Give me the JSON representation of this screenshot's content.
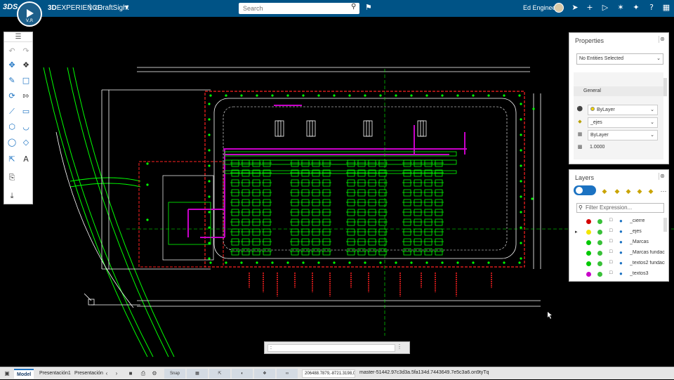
{
  "topbar": {
    "logo": "3DS",
    "compass_version": "V,R",
    "brand_bold": "3D",
    "brand_rest": "EXPERIENCE",
    "separator": "|",
    "app_name": "xDraftSight",
    "search_placeholder": "Search",
    "user_name": "Ed Engineer",
    "icons": [
      "tag-icon",
      "share-icon",
      "plus-icon",
      "play-icon",
      "network-icon",
      "tools-icon",
      "help-icon",
      "grid-icon"
    ]
  },
  "toolbar": {
    "handle": "☰",
    "tools": [
      "undo-icon",
      "redo-icon",
      "move-icon",
      "select-icon",
      "pen-icon",
      "rectangle-icon",
      "rotate-icon",
      "arrow-icon",
      "line-icon",
      "box-icon",
      "polygon-icon",
      "arc-icon",
      "circle-icon",
      "shape-icon",
      "dimension-icon",
      "text-icon",
      "clipboard-icon",
      "import-icon"
    ]
  },
  "properties": {
    "title": "Properties",
    "selection": "No Entities Selected",
    "section": "General",
    "rows": [
      {
        "icon": "color-icon",
        "value": "ByLayer",
        "color": "#f2d300"
      },
      {
        "icon": "layer-icon",
        "value": "_ejes"
      },
      {
        "icon": "linetype-icon",
        "value": "ByLayer"
      },
      {
        "icon": "scale-icon",
        "value": "1.0000"
      }
    ]
  },
  "layers": {
    "title": "Layers",
    "filter_placeholder": "Filter Expression...",
    "rows": [
      {
        "name": "_cierre",
        "color": "#d40000"
      },
      {
        "name": "_ejes",
        "color": "#f2e600"
      },
      {
        "name": "_Marcas",
        "color": "#00c800"
      },
      {
        "name": "_Marcas fundaci...",
        "color": "#00c800"
      },
      {
        "name": "_textos2 fundaci...",
        "color": "#00c800"
      },
      {
        "name": "_textos3",
        "color": "#c800c8"
      }
    ]
  },
  "command": {
    "prompt": ":"
  },
  "status": {
    "tabs": [
      "Model",
      "Presentación1",
      "Presentación"
    ],
    "snap": "Snap",
    "coords": "206488.7879,-8721.3198,0",
    "build": "master-51442.97c3d3a.5fa134d.7443649.7e5c3a6.on9tyTq"
  },
  "colors": {
    "topbar": "#005386",
    "accent": "#1b72c2",
    "cad_green": "#00ff00",
    "cad_magenta": "#c800c8",
    "cad_red": "#ff2020"
  }
}
